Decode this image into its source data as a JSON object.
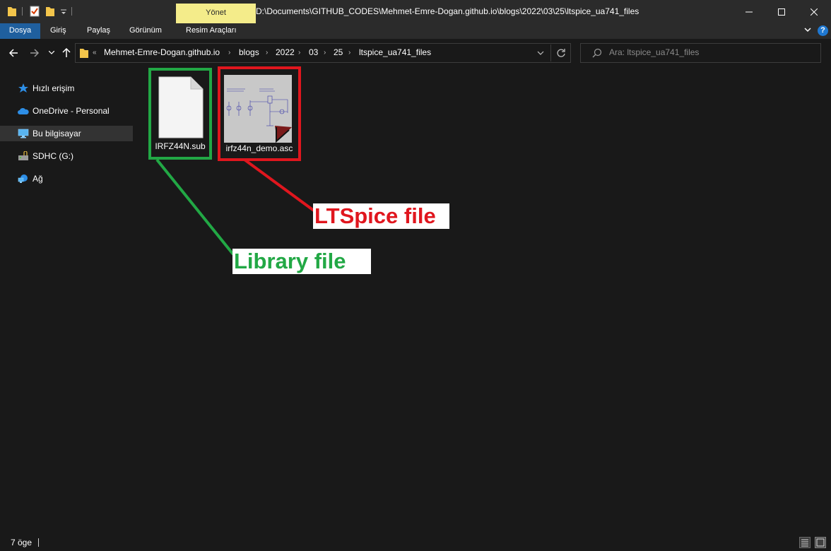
{
  "titlebar": {
    "manage_tab": "Yönet",
    "path": "D:\\Documents\\GITHUB_CODES\\Mehmet-Emre-Dogan.github.io\\blogs\\2022\\03\\25\\ltspice_ua741_files",
    "minimize_icon": "minimize-icon",
    "maximize_icon": "maximize-icon",
    "close_icon": "close-icon"
  },
  "ribbon": {
    "tabs": [
      "Dosya",
      "Giriş",
      "Paylaş",
      "Görünüm",
      "Resim Araçları"
    ]
  },
  "address": {
    "overflow": "«",
    "breadcrumbs": [
      "Mehmet-Emre-Dogan.github.io",
      "blogs",
      "2022",
      "03",
      "25",
      "ltspice_ua741_files"
    ]
  },
  "search": {
    "placeholder": "Ara: ltspice_ua741_files"
  },
  "sidebar": {
    "items": [
      {
        "label": "Hızlı erişim",
        "icon": "star-icon"
      },
      {
        "label": "OneDrive - Personal",
        "icon": "cloud-icon"
      },
      {
        "label": "Bu bilgisayar",
        "icon": "computer-icon",
        "selected": true
      },
      {
        "label": "SDHC (G:)",
        "icon": "drive-icon"
      },
      {
        "label": "Ağ",
        "icon": "network-icon"
      }
    ]
  },
  "files": [
    {
      "name": "IRFZ44N.sub",
      "type": "document"
    },
    {
      "name": "irfz44n_demo.asc",
      "type": "ltspice-schematic"
    }
  ],
  "annotations": {
    "library": "Library file",
    "ltspice": "LTSpice file",
    "green": "#22a845",
    "red": "#e0161e"
  },
  "status": {
    "count": "7 öge"
  }
}
